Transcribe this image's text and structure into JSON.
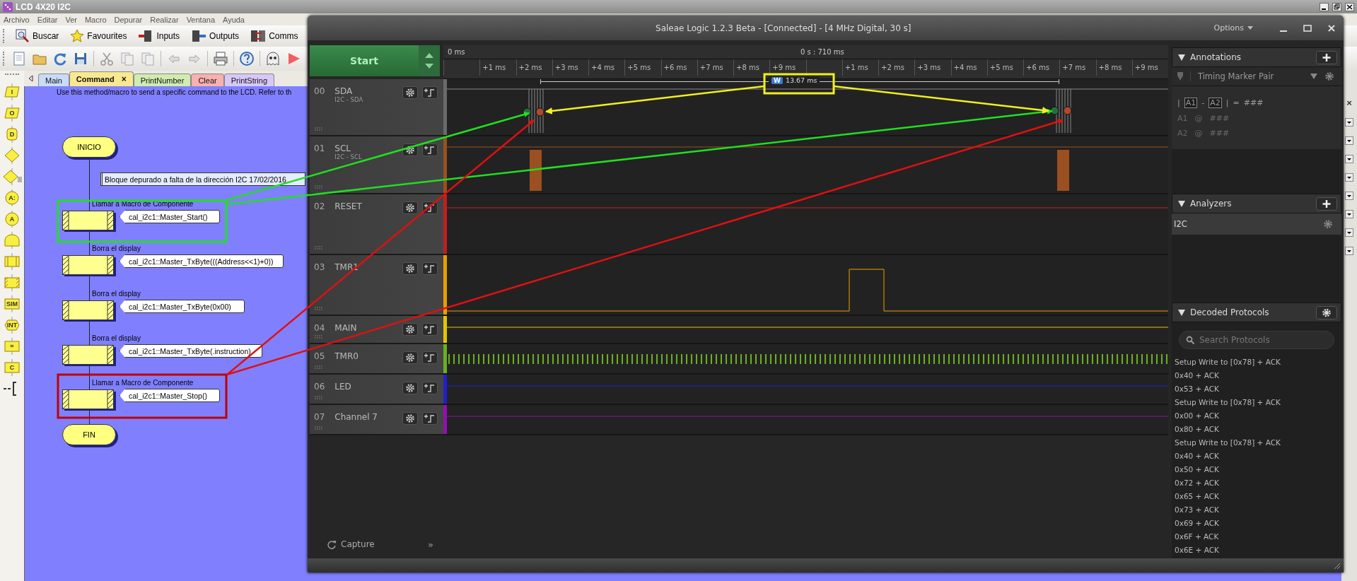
{
  "flowcode": {
    "title": "LCD 4X20 I2C",
    "menu": [
      "Archivo",
      "Editar",
      "Ver",
      "Macro",
      "Depurar",
      "Realizar",
      "Ventana",
      "Ayuda"
    ],
    "toolbar": [
      {
        "kind": "search",
        "label": "Buscar"
      },
      {
        "kind": "star",
        "label": "Favourites"
      },
      {
        "kind": "input",
        "label": "Inputs"
      },
      {
        "kind": "output",
        "label": "Outputs"
      },
      {
        "kind": "comms",
        "label": "Comms"
      }
    ],
    "tabs": [
      {
        "label": "Main",
        "selected": false,
        "color": "#c8dcf8"
      },
      {
        "label": "Command",
        "selected": true,
        "color": "#f8e890",
        "close": "×"
      },
      {
        "label": "PrintNumber",
        "selected": false,
        "color": "#d0ecb0"
      },
      {
        "label": "Clear",
        "selected": false,
        "color": "#f8b0b0"
      },
      {
        "label": "PrintString",
        "selected": false,
        "color": "#d8c8f8"
      }
    ],
    "palette": [
      {
        "kind": "io",
        "label": "I"
      },
      {
        "kind": "io",
        "label": "O"
      },
      {
        "kind": "delay",
        "label": "D"
      },
      {
        "kind": "decision"
      },
      {
        "kind": "switch"
      },
      {
        "kind": "connector",
        "label": "A:"
      },
      {
        "kind": "connector",
        "label": "A"
      },
      {
        "kind": "loop"
      },
      {
        "kind": "macro"
      },
      {
        "kind": "component"
      },
      {
        "kind": "block",
        "label": "SIM"
      },
      {
        "kind": "interrupt",
        "label": "INT"
      },
      {
        "kind": "block",
        "label": "="
      },
      {
        "kind": "block",
        "label": "C"
      },
      {
        "kind": "comment"
      }
    ],
    "description": "Use this method/macro to send a specific command to the LCD. Refer to th",
    "flowchart": {
      "start": "INICIO",
      "comment": "Bloque depurado a falta de la dirección I2C  17/02/2016",
      "steps": [
        {
          "label": "Llamar a Macro de Componente",
          "call": "cal_i2c1::Master_Start()"
        },
        {
          "label": "Borra el display",
          "call": "cal_i2c1::Master_TxByte(((Address<<1)+0))"
        },
        {
          "label": "Borra el display",
          "call": "cal_i2c1::Master_TxByte(0x00)"
        },
        {
          "label": "Borra el display",
          "call": "cal_i2c1::Master_TxByte(.instruction)"
        },
        {
          "label": "Llamar a Macro de Componente",
          "call": "cal_i2c1::Master_Stop()"
        }
      ],
      "end": "FIN"
    },
    "side_close": "×"
  },
  "saleae": {
    "title": "Saleae Logic 1.2.3 Beta - [Connected] - [4 MHz Digital, 30 s]",
    "options": "Options",
    "start": "Start",
    "ruler": {
      "left": "0 ms",
      "center": "0 s : 710 ms",
      "ticks": [
        "+1 ms",
        "+2 ms",
        "+3 ms",
        "+4 ms",
        "+5 ms",
        "+6 ms",
        "+7 ms",
        "+8 ms",
        "+9 ms",
        "+1 ms",
        "+2 ms",
        "+3 ms",
        "+4 ms",
        "+5 ms",
        "+6 ms",
        "+7 ms",
        "+8 ms",
        "+9 ms"
      ]
    },
    "measurement": {
      "badge": "W",
      "value": "13.67 ms"
    },
    "channels": [
      {
        "number": "00",
        "name": "SDA",
        "analyzer": "I2C - SDA",
        "color": "#6a6a6a"
      },
      {
        "number": "01",
        "name": "SCL",
        "analyzer": "I2C - SCL",
        "color": "#9a5020"
      },
      {
        "number": "02",
        "name": "RESET",
        "color": "#c02020"
      },
      {
        "number": "03",
        "name": "TMR1",
        "color": "#e8a000"
      },
      {
        "number": "04",
        "name": "MAIN",
        "color": "#e0c800"
      },
      {
        "number": "05",
        "name": "TMR0",
        "color": "#6ab020"
      },
      {
        "number": "06",
        "name": "LED",
        "color": "#2020d0"
      },
      {
        "number": "07",
        "name": "Channel 7",
        "color": "#9010b0"
      }
    ],
    "capture": "Capture",
    "capture_more": "»",
    "annotations": {
      "title": "Annotations",
      "type": "Timing Marker Pair",
      "formula": [
        {
          "kind": "text",
          "text": "|"
        },
        {
          "kind": "marker",
          "text": "A1"
        },
        {
          "kind": "text",
          "text": "-"
        },
        {
          "kind": "marker",
          "text": "A2"
        },
        {
          "kind": "text",
          "text": "|"
        },
        {
          "kind": "text",
          "text": "="
        },
        {
          "kind": "text",
          "text": "###"
        }
      ],
      "markers": [
        {
          "name": "A1",
          "at": "@",
          "value": "###"
        },
        {
          "name": "A2",
          "at": "@",
          "value": "###"
        }
      ]
    },
    "analyzers": {
      "title": "Analyzers",
      "items": [
        {
          "name": "I2C"
        }
      ]
    },
    "decoded": {
      "title": "Decoded Protocols",
      "placeholder": "Search Protocols",
      "rows": [
        "Setup Write to [0x78] + ACK",
        "0x40 + ACK",
        "0x53 + ACK",
        "Setup Write to [0x78] + ACK",
        "0x00 + ACK",
        "0x80 + ACK",
        "Setup Write to [0x78] + ACK",
        "0x40 + ACK",
        "0x50 + ACK",
        "0x72 + ACK",
        "0x65 + ACK",
        "0x73 + ACK",
        "0x69 + ACK",
        "0x6F + ACK",
        "0x6E + ACK"
      ]
    }
  }
}
